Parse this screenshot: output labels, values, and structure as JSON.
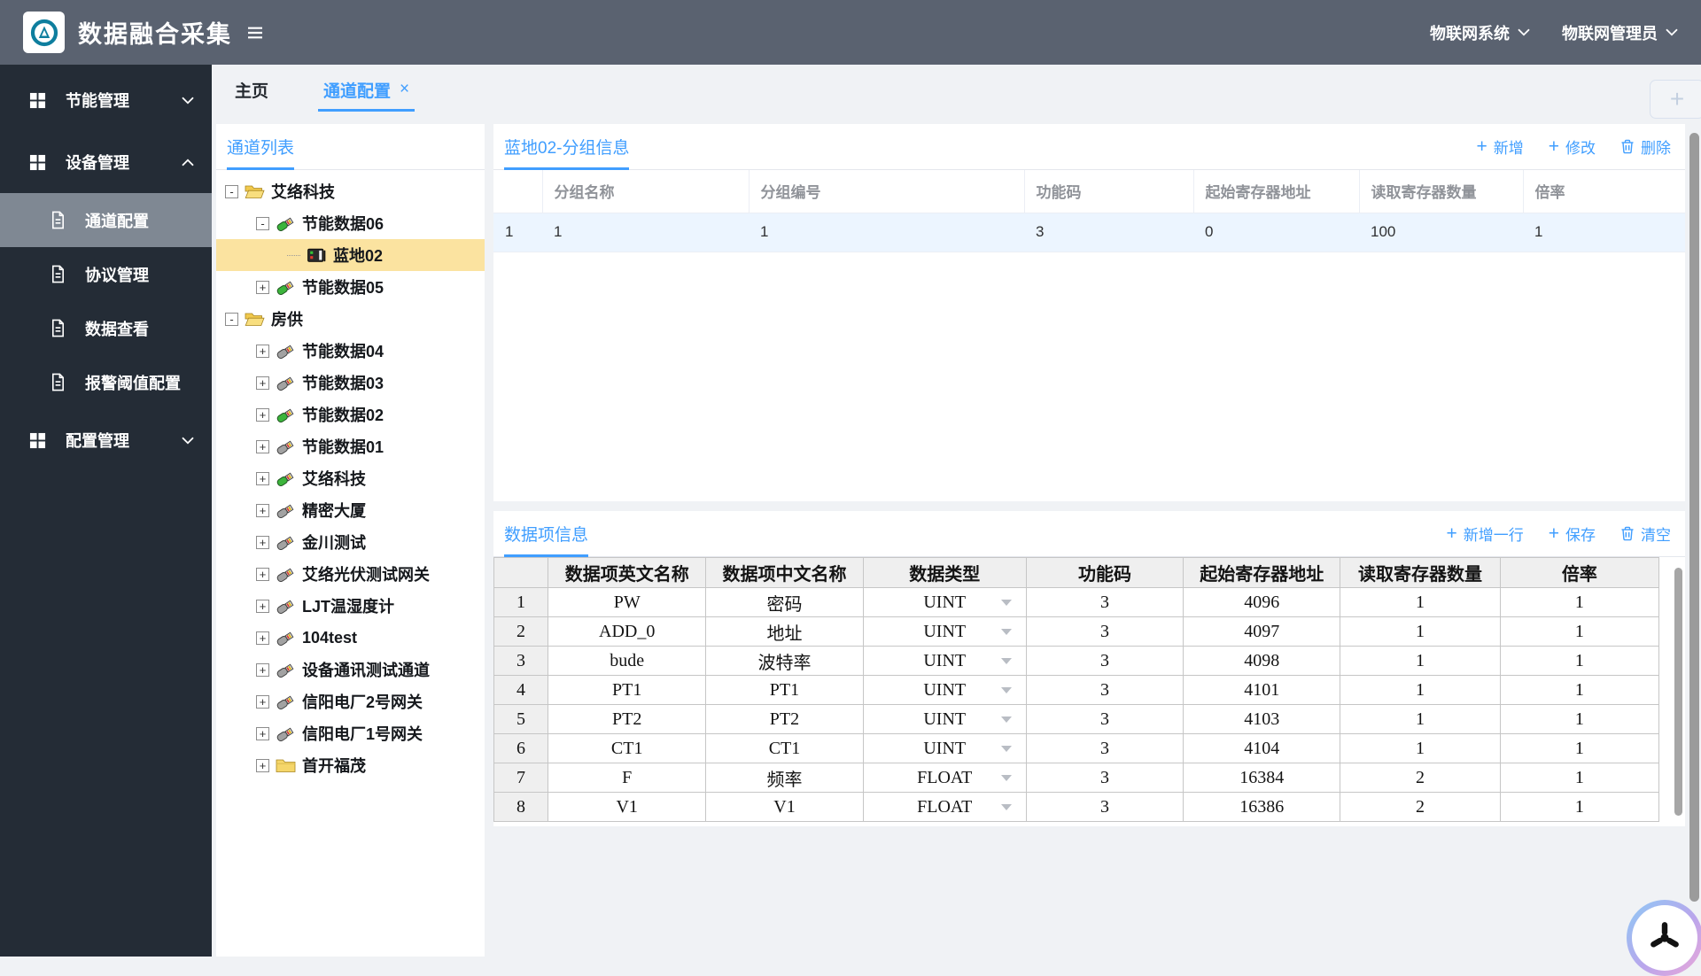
{
  "header": {
    "title": "数据融合采集",
    "system_menu": "物联网系统",
    "user_menu": "物联网管理员"
  },
  "sidebar": {
    "groups": [
      {
        "label": "节能管理",
        "expanded": false,
        "children": []
      },
      {
        "label": "设备管理",
        "expanded": true,
        "children": [
          {
            "label": "通道配置",
            "active": true
          },
          {
            "label": "协议管理",
            "active": false
          },
          {
            "label": "数据查看",
            "active": false
          },
          {
            "label": "报警阈值配置",
            "active": false
          }
        ]
      },
      {
        "label": "配置管理",
        "expanded": false,
        "children": []
      }
    ]
  },
  "tabs": {
    "items": [
      {
        "label": "主页",
        "active": false,
        "closable": false
      },
      {
        "label": "通道配置",
        "active": true,
        "closable": true
      }
    ],
    "close_glyph": "×",
    "add_glyph": "+"
  },
  "tree": {
    "title": "通道列表",
    "nodes": [
      {
        "label": "艾络科技",
        "level": 0,
        "icon": "folder-open",
        "expander": "minus",
        "selected": false
      },
      {
        "label": "节能数据06",
        "level": 1,
        "icon": "device-green",
        "expander": "minus",
        "selected": false
      },
      {
        "label": "蓝地02",
        "level": 2,
        "icon": "meter",
        "expander": "none",
        "selected": true
      },
      {
        "label": "节能数据05",
        "level": 1,
        "icon": "device-green",
        "expander": "plus",
        "selected": false
      },
      {
        "label": "房供",
        "level": 0,
        "icon": "folder-open",
        "expander": "minus",
        "selected": false
      },
      {
        "label": "节能数据04",
        "level": 1,
        "icon": "device-gray",
        "expander": "plus",
        "selected": false
      },
      {
        "label": "节能数据03",
        "level": 1,
        "icon": "device-gray",
        "expander": "plus",
        "selected": false
      },
      {
        "label": "节能数据02",
        "level": 1,
        "icon": "device-green",
        "expander": "plus",
        "selected": false
      },
      {
        "label": "节能数据01",
        "level": 1,
        "icon": "device-gray",
        "expander": "plus",
        "selected": false
      },
      {
        "label": "艾络科技",
        "level": 1,
        "icon": "device-green",
        "expander": "plus",
        "selected": false
      },
      {
        "label": "精密大厦",
        "level": 1,
        "icon": "device-gray",
        "expander": "plus",
        "selected": false
      },
      {
        "label": "金川测试",
        "level": 1,
        "icon": "device-gray",
        "expander": "plus",
        "selected": false
      },
      {
        "label": "艾络光伏测试网关",
        "level": 1,
        "icon": "device-gray",
        "expander": "plus",
        "selected": false
      },
      {
        "label": "LJT温湿度计",
        "level": 1,
        "icon": "device-gray",
        "expander": "plus",
        "selected": false
      },
      {
        "label": "104test",
        "level": 1,
        "icon": "device-gray",
        "expander": "plus",
        "selected": false
      },
      {
        "label": "设备通讯测试通道",
        "level": 1,
        "icon": "device-gray",
        "expander": "plus",
        "selected": false
      },
      {
        "label": "信阳电厂2号网关",
        "level": 1,
        "icon": "device-gray",
        "expander": "plus",
        "selected": false
      },
      {
        "label": "信阳电厂1号网关",
        "level": 1,
        "icon": "device-gray",
        "expander": "plus",
        "selected": false
      },
      {
        "label": "首开福茂",
        "level": 1,
        "icon": "folder-closed",
        "expander": "plus",
        "selected": false
      }
    ]
  },
  "group_panel": {
    "title": "蓝地02-分组信息",
    "buttons": {
      "add": "新增",
      "edit": "修改",
      "delete": "删除"
    },
    "columns": [
      "",
      "分组名称",
      "分组编号",
      "功能码",
      "起始寄存器地址",
      "读取寄存器数量",
      "倍率"
    ],
    "rows": [
      [
        "1",
        "1",
        "1",
        "3",
        "0",
        "100",
        "1"
      ]
    ],
    "selected_row_index": 0
  },
  "items_panel": {
    "title": "数据项信息",
    "buttons": {
      "add_row": "新增一行",
      "save": "保存",
      "clear": "清空"
    },
    "columns": [
      "",
      "数据项英文名称",
      "数据项中文名称",
      "数据类型",
      "功能码",
      "起始寄存器地址",
      "读取寄存器数量",
      "倍率"
    ],
    "type_column_index": 3,
    "rows": [
      [
        "1",
        "PW",
        "密码",
        "UINT",
        "3",
        "4096",
        "1",
        "1"
      ],
      [
        "2",
        "ADD_0",
        "地址",
        "UINT",
        "3",
        "4097",
        "1",
        "1"
      ],
      [
        "3",
        "bude",
        "波特率",
        "UINT",
        "3",
        "4098",
        "1",
        "1"
      ],
      [
        "4",
        "PT1",
        "PT1",
        "UINT",
        "3",
        "4101",
        "1",
        "1"
      ],
      [
        "5",
        "PT2",
        "PT2",
        "UINT",
        "3",
        "4103",
        "1",
        "1"
      ],
      [
        "6",
        "CT1",
        "CT1",
        "UINT",
        "3",
        "4104",
        "1",
        "1"
      ],
      [
        "7",
        "F",
        "频率",
        "FLOAT",
        "3",
        "16384",
        "2",
        "1"
      ],
      [
        "8",
        "V1",
        "V1",
        "FLOAT",
        "3",
        "16386",
        "2",
        "1"
      ]
    ]
  },
  "colors": {
    "accent": "#409eff",
    "topbar_bg": "#5a6270",
    "sidebar_bg": "#242c36",
    "sidebar_active_bg": "#7f8893",
    "tree_selected_bg": "#fbe3a0",
    "table_selected_row_bg": "#ecf5ff"
  }
}
